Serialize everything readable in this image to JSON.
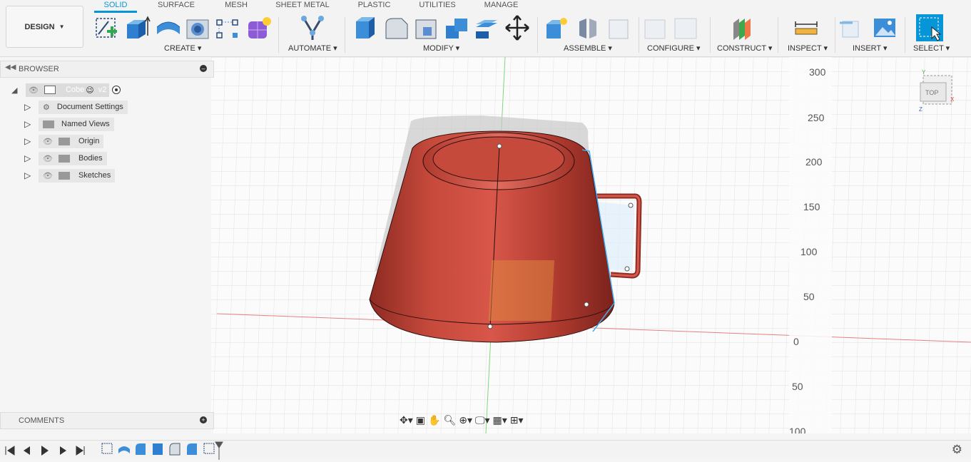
{
  "workspace": {
    "label": "DESIGN"
  },
  "tabs": [
    {
      "label": "SOLID",
      "active": true
    },
    {
      "label": "SURFACE"
    },
    {
      "label": "MESH"
    },
    {
      "label": "SHEET METAL"
    },
    {
      "label": "PLASTIC"
    },
    {
      "label": "UTILITIES"
    },
    {
      "label": "MANAGE"
    }
  ],
  "groups": {
    "create": "CREATE",
    "automate": "AUTOMATE",
    "modify": "MODIFY",
    "assemble": "ASSEMBLE",
    "configure": "CONFIGURE",
    "construct": "CONSTRUCT",
    "inspect": "INSPECT",
    "insert": "INSERT",
    "select": "SELECT"
  },
  "browser": {
    "title": "BROWSER",
    "root": {
      "name": "Cobe",
      "emoji": "😉",
      "version": "v2"
    },
    "items": [
      {
        "label": "Document Settings",
        "icon": "gear-icon"
      },
      {
        "label": "Named Views",
        "icon": "folder-icon"
      },
      {
        "label": "Origin",
        "icon": "folder-icon"
      },
      {
        "label": "Bodies",
        "icon": "folder-icon"
      },
      {
        "label": "Sketches",
        "icon": "folder-icon"
      }
    ]
  },
  "comments": {
    "title": "COMMENTS"
  },
  "viewcube": {
    "face": "TOP",
    "axes": [
      "Y",
      "X",
      "Z"
    ]
  },
  "ruler": [
    "300",
    "250",
    "200",
    "150",
    "100",
    "50",
    "0",
    "50",
    "100"
  ],
  "colors": {
    "accent": "#0696d7",
    "cup": "#c8463c",
    "grid": "#d6d6d6"
  }
}
